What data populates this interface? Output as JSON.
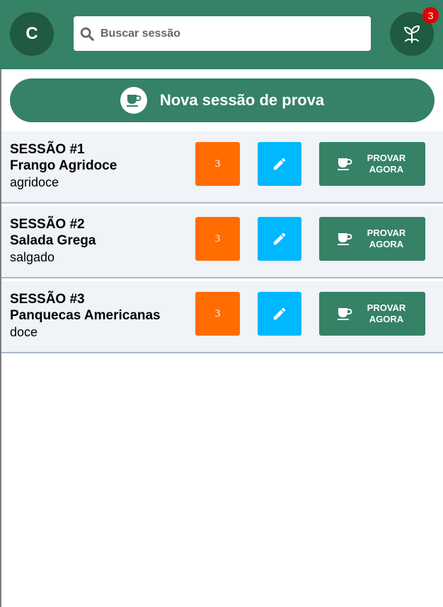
{
  "header": {
    "avatar_initial": "C",
    "search_placeholder": "Buscar sessão",
    "notification_count": "3",
    "icons": {
      "search": "search-icon",
      "plant": "sprout-icon"
    }
  },
  "new_session": {
    "label": "Nova sessão de prova",
    "icon": "coffee-cup-icon"
  },
  "sessions": [
    {
      "id_label": "SESSÃO #1",
      "dish": "Frango Agridoce",
      "category": "agridoce",
      "count": "3",
      "action_label": "PROVAR AGORA"
    },
    {
      "id_label": "SESSÃO #2",
      "dish": "Salada Grega",
      "category": "salgado",
      "count": "3",
      "action_label": "PROVAR AGORA"
    },
    {
      "id_label": "SESSÃO #3",
      "dish": "Panquecas Americanas",
      "category": "doce",
      "count": "3",
      "action_label": "PROVAR AGORA"
    }
  ],
  "colors": {
    "header": "#358266",
    "avatar": "#1f5a41",
    "count_button": "#ff6d00",
    "edit_button": "#00b8ff",
    "badge": "#e00000",
    "row_background": "#f0f3f8"
  }
}
